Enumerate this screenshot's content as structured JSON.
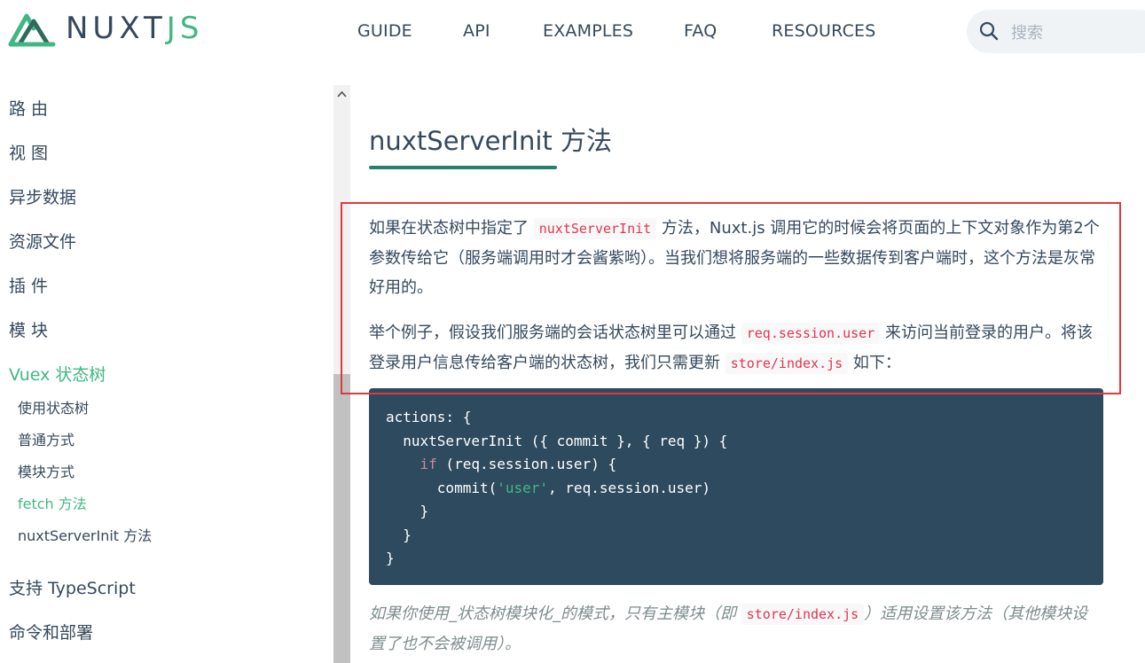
{
  "header": {
    "logo_nuxt": "NUXT",
    "logo_js": "JS",
    "nav": [
      "GUIDE",
      "API",
      "EXAMPLES",
      "FAQ",
      "RESOURCES"
    ],
    "search_placeholder": "搜索"
  },
  "sidebar": {
    "items": [
      "路 由",
      "视 图",
      "异步数据",
      "资源文件",
      "插 件",
      "模 块",
      "Vuex 状态树"
    ],
    "sub_items": [
      "使用状态树",
      "普通方式",
      "模块方式",
      "fetch 方法",
      "nuxtServerInit 方法"
    ],
    "items_after": [
      "支持 TypeScript",
      "命令和部署"
    ],
    "active_item": "Vuex 状态树",
    "active_sub_item": "fetch 方法"
  },
  "main": {
    "title": "nuxtServerInit 方法",
    "para1": {
      "t1": "如果在状态树中指定了 ",
      "code1": "nuxtServerInit",
      "t2": " 方法，Nuxt.js 调用它的时候会将页面的上下文对象作为第2个参数传给它（服务端调用时才会酱紫哟）。当我们想将服务端的一些数据传到客户端时，这个方法是灰常好用的。"
    },
    "para2": {
      "t1": "举个例子，假设我们服务端的会话状态树里可以通过 ",
      "code1": "req.session.user",
      "t2": " 来访问当前登录的用户。将该登录用户信息传给客户端的状态树，我们只需更新 ",
      "code2": "store/index.js",
      "t3": " 如下："
    },
    "code": {
      "l1": "actions: {",
      "l2": "  nuxtServerInit ({ commit }, { req }) {",
      "l3_indent": "    ",
      "l3_kw": "if",
      "l3_rest": " (req.session.user) {",
      "l4_a": "      commit(",
      "l4_str": "'user'",
      "l4_b": ", req.session.user)",
      "l5": "    }",
      "l6": "  }",
      "l7": "}"
    },
    "note": {
      "t1": "如果你使用_状态树模块化_的模式，只有主模块（即 ",
      "code1": "store/index.js",
      "t2": "）适用设置该方法（其他模块设置了也不会被调用）。"
    }
  },
  "colors": {
    "brand_green": "#41b883",
    "text_dark": "#35495e",
    "code_bg": "#2e4a5e",
    "highlight_border": "#e0393e"
  }
}
